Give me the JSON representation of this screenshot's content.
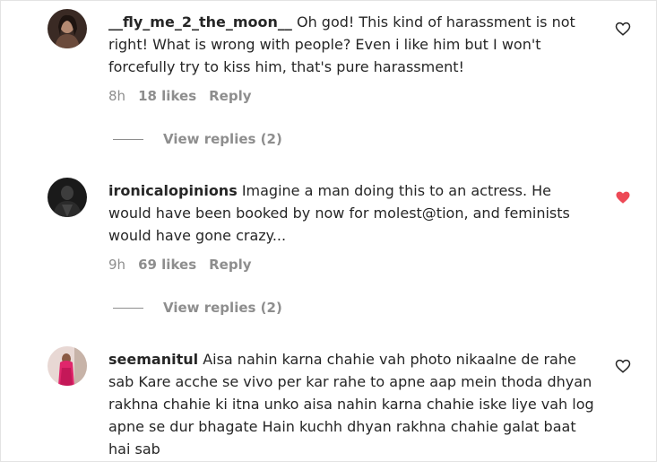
{
  "comments": [
    {
      "username": "__fly_me_2_the_moon__",
      "text": "Oh god! This kind of harassment is not right! What is wrong with people? Even i like him but I won't forcefully try to kiss him, that's pure harassment!",
      "time": "8h",
      "likes": "18 likes",
      "reply_label": "Reply",
      "view_replies": "View replies (2)",
      "liked": false
    },
    {
      "username": "ironicalopinions",
      "text": "Imagine a man doing this to an actress. He would have been booked by now for molest@tion, and feminists would have gone crazy...",
      "time": "9h",
      "likes": "69 likes",
      "reply_label": "Reply",
      "view_replies": "View replies (2)",
      "liked": true
    },
    {
      "username": "seemanitul",
      "text": "Aisa nahin karna chahie vah photo nikaalne de rahe sab Kare acche se vivo per kar rahe to apne aap mein thoda dhyan rakhna chahie ki itna unko aisa nahin karna chahie iske liye vah log apne se dur bhagate Hain kuchh dhyan rakhna chahie galat baat hai sab",
      "liked": false
    }
  ],
  "colors": {
    "text": "#262626",
    "muted": "#8e8e8e",
    "liked_heart": "#ed4956"
  },
  "icons": {
    "like": "heart-outline-icon",
    "liked": "heart-filled-icon"
  }
}
